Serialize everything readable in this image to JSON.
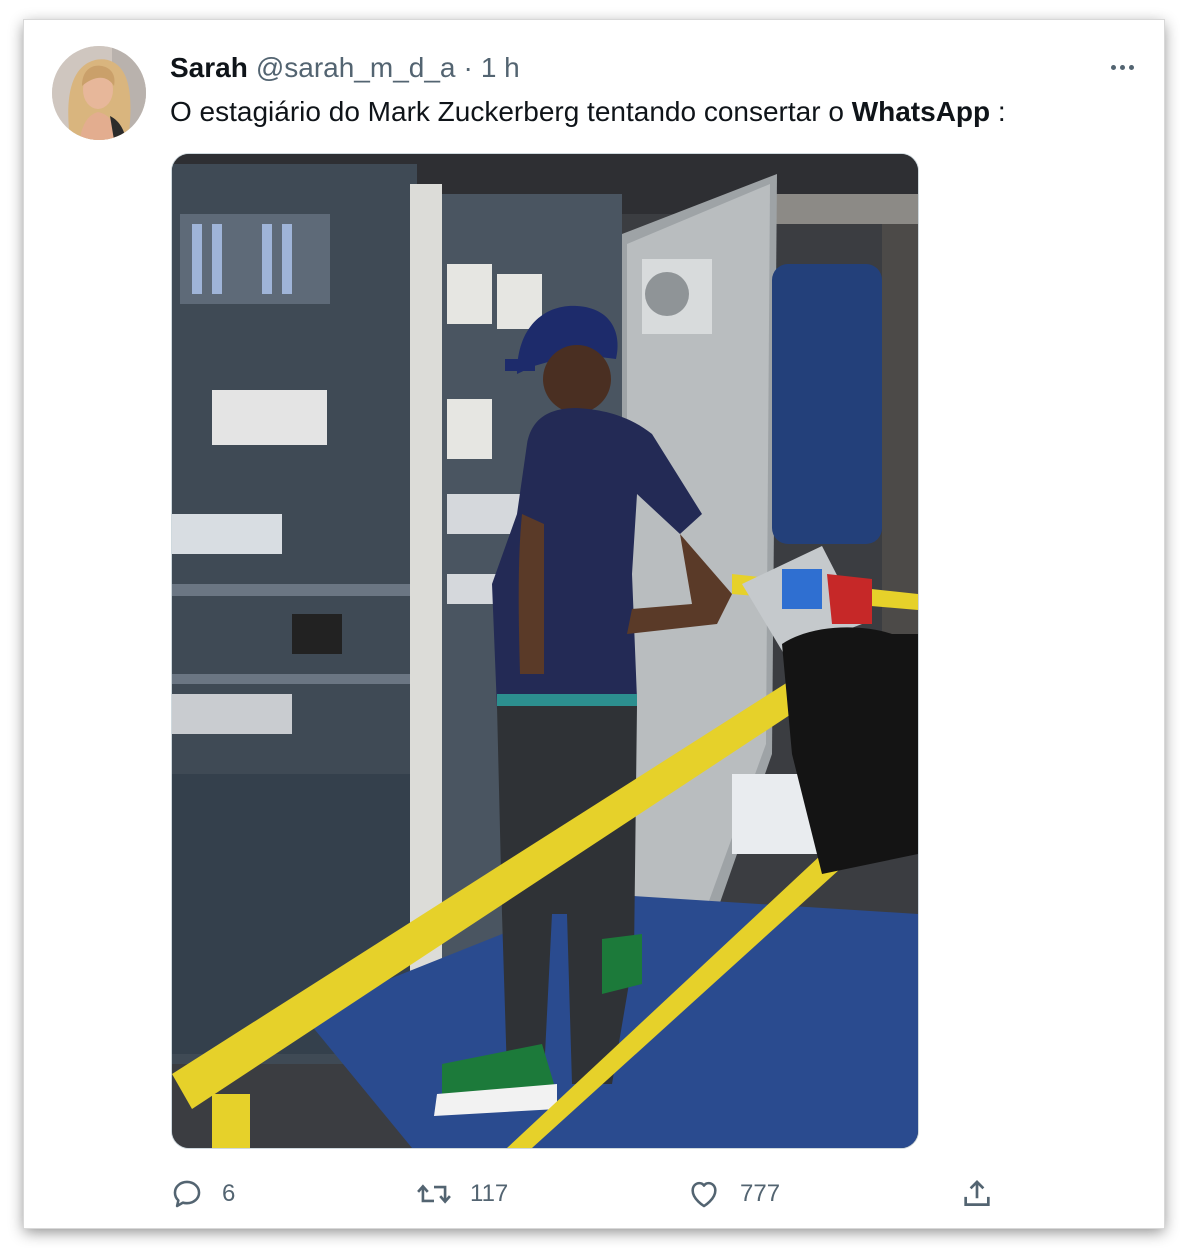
{
  "tweet": {
    "author": {
      "display_name": "Sarah",
      "handle": "@sarah_m_d_a",
      "avatar_icon": "profile-photo"
    },
    "separator": "·",
    "time": "1 h",
    "text_before": "O estagiário do Mark Zuckerberg tentando consertar o ",
    "text_bold": "WhatsApp",
    "text_after": " :",
    "media": {
      "kind": "photo"
    },
    "actions": {
      "reply": {
        "icon": "reply-icon",
        "count": "6"
      },
      "retweet": {
        "icon": "retweet-icon",
        "count": "117"
      },
      "like": {
        "icon": "heart-icon",
        "count": "777"
      },
      "share": {
        "icon": "share-icon"
      }
    }
  },
  "colors": {
    "text_primary": "#0f1419",
    "text_secondary": "#536471",
    "border": "#cfd9de"
  }
}
